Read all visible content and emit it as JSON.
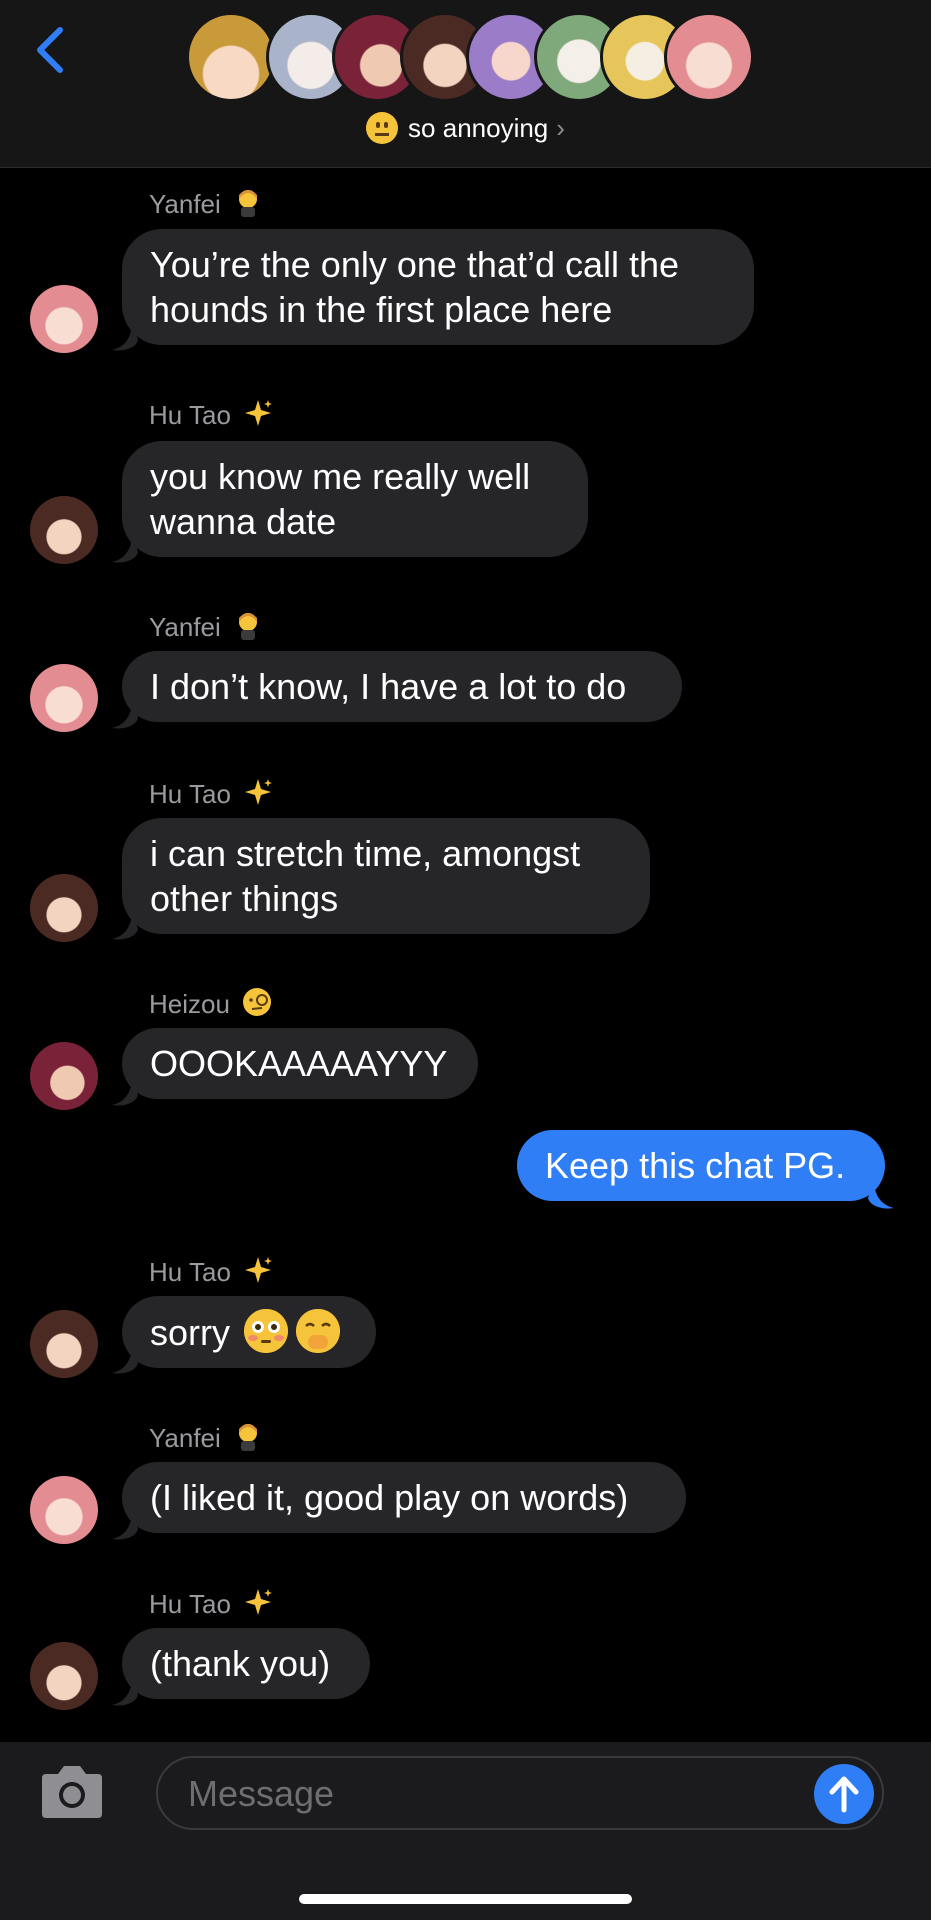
{
  "header": {
    "back_icon": "chevron-left-icon",
    "group_emoji": "neutral-face-emoji",
    "group_name": "so annoying",
    "chevron": "›",
    "member_avatars": [
      "avatar-1",
      "avatar-2",
      "avatar-3",
      "avatar-4",
      "avatar-5",
      "avatar-6",
      "avatar-7",
      "avatar-8"
    ]
  },
  "messages": [
    {
      "sender": "Yanfei",
      "badge": "woman-judge-emoji",
      "lines": [
        "You’re the only one that’d call the",
        "hounds in the first place here"
      ],
      "direction": "in"
    },
    {
      "sender": "Hu Tao",
      "badge": "sparkles-emoji",
      "lines": [
        "you know me really well",
        "wanna date"
      ],
      "direction": "in"
    },
    {
      "sender": "Yanfei",
      "badge": "woman-judge-emoji",
      "lines": [
        "I don’t know, I have a lot to do"
      ],
      "direction": "in"
    },
    {
      "sender": "Hu Tao",
      "badge": "sparkles-emoji",
      "lines": [
        "i can stretch time, amongst",
        "other things"
      ],
      "direction": "in"
    },
    {
      "sender": "Heizou",
      "badge": "face-with-monocle-emoji",
      "lines": [
        "OOOKAAAAAYYY"
      ],
      "direction": "in"
    },
    {
      "sender": "",
      "badge": "",
      "lines": [
        "Keep this chat PG."
      ],
      "direction": "out"
    },
    {
      "sender": "Hu Tao",
      "badge": "sparkles-emoji",
      "lines": [
        "sorry"
      ],
      "direction": "in",
      "trailing_emoji": [
        "flushed-face-emoji",
        "face-with-hand-over-mouth-emoji"
      ]
    },
    {
      "sender": "Yanfei",
      "badge": "woman-judge-emoji",
      "lines": [
        "(I liked it, good play on words)"
      ],
      "direction": "in"
    },
    {
      "sender": "Hu Tao",
      "badge": "sparkles-emoji",
      "lines": [
        "(thank you)"
      ],
      "direction": "in"
    }
  ],
  "composer": {
    "camera_icon": "camera-icon",
    "placeholder": "Message",
    "send_icon": "arrow-up-icon"
  },
  "colors": {
    "accent_blue": "#2f7ef6",
    "incoming_bubble": "#262629",
    "background": "#000000"
  }
}
